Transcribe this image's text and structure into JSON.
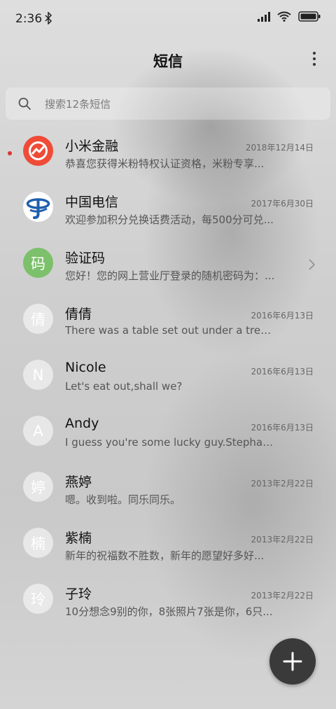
{
  "status_bar": {
    "time": "2:36",
    "icons": [
      "bluetooth-icon",
      "signal-icon",
      "wifi-icon",
      "battery-icon"
    ]
  },
  "header": {
    "title": "短信",
    "more_icon": "more-vertical-icon"
  },
  "search": {
    "placeholder": "搜索12条短信",
    "icon": "search-icon"
  },
  "messages": [
    {
      "sender": "小米金融",
      "date": "2018年12月14日",
      "preview": "恭喜您获得米粉特权认证资格，米粉专享...",
      "unread": true,
      "avatar": "mi-finance-logo"
    },
    {
      "sender": "中国电信",
      "date": "2017年6月30日",
      "preview": "欢迎参加积分兑换话费活动，每500分可兑...",
      "avatar": "china-telecom-logo"
    },
    {
      "sender": "验证码",
      "date": "",
      "preview": "您好！您的网上营业厅登录的随机密码为：...",
      "avatar_text": "码",
      "has_chevron": true
    },
    {
      "sender": "倩倩",
      "date": "2016年6月13日",
      "preview": "There was a table set out under a tree in...",
      "avatar_text": "倩"
    },
    {
      "sender": "Nicole",
      "date": "2016年6月13日",
      "preview": "Let's eat out,shall we?",
      "avatar_text": "N"
    },
    {
      "sender": "Andy",
      "date": "2016年6月13日",
      "preview": "I guess you're some lucky guy.Stephani...",
      "avatar_text": "A"
    },
    {
      "sender": "燕婷",
      "date": "2013年2月22日",
      "preview": "嗯。收到啦。同乐同乐。",
      "avatar_text": "婷"
    },
    {
      "sender": "紫楠",
      "date": "2013年2月22日",
      "preview": "新年的祝福数不胜数，新年的愿望好多好...",
      "avatar_text": "楠"
    },
    {
      "sender": "子玲",
      "date": "2013年2月22日",
      "preview": "10分想念9别的你，8张照片7张是你，6只...",
      "avatar_text": "玲"
    }
  ],
  "fab": {
    "icon": "plus-icon"
  },
  "colors": {
    "unread_dot": "#d8382f",
    "mi_finance": "#ef4b37",
    "telecom_blue": "#1f5fae",
    "code_green": "#7cc06b",
    "fab_bg": "#3a3a3a"
  }
}
